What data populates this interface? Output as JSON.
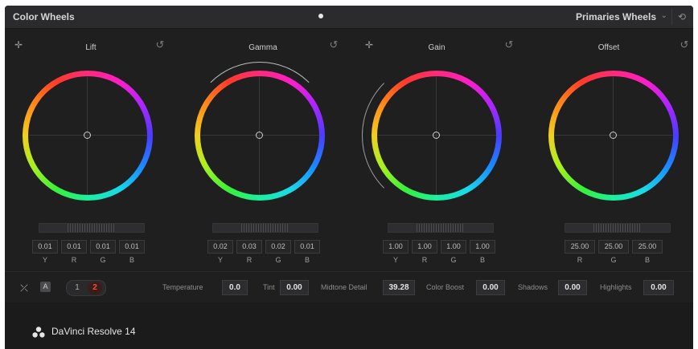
{
  "window": {
    "title": "Color Wheels",
    "mode": "Primaries Wheels"
  },
  "wheels": [
    {
      "label": "Lift",
      "values": [
        "0.01",
        "0.01",
        "0.01",
        "0.01"
      ],
      "channels": [
        "Y",
        "R",
        "G",
        "B"
      ]
    },
    {
      "label": "Gamma",
      "values": [
        "0.02",
        "0.03",
        "0.02",
        "0.01"
      ],
      "channels": [
        "Y",
        "R",
        "G",
        "B"
      ]
    },
    {
      "label": "Gain",
      "values": [
        "1.00",
        "1.00",
        "1.00",
        "1.00"
      ],
      "channels": [
        "Y",
        "R",
        "G",
        "B"
      ]
    },
    {
      "label": "Offset",
      "values": [
        "25.00",
        "25.00",
        "25.00"
      ],
      "channels": [
        "R",
        "G",
        "B"
      ]
    }
  ],
  "params": {
    "badge": "A",
    "pages": [
      "1",
      "2"
    ],
    "active_page": "2",
    "temperature": {
      "label": "Temperature",
      "value": "0.0"
    },
    "tint": {
      "label": "Tint",
      "value": "0.00"
    },
    "midtone_detail": {
      "label": "Midtone Detail",
      "value": "39.28"
    },
    "color_boost": {
      "label": "Color Boost",
      "value": "0.00"
    },
    "shadows": {
      "label": "Shadows",
      "value": "0.00"
    },
    "highlights": {
      "label": "Highlights",
      "value": "0.00"
    }
  },
  "footer": {
    "brand": "DaVinci Resolve 14"
  },
  "icons": {
    "picker": "color-picker-icon",
    "reset": "reset-icon",
    "curves": "curves-icon",
    "logo": "davinci-logo-icon"
  }
}
